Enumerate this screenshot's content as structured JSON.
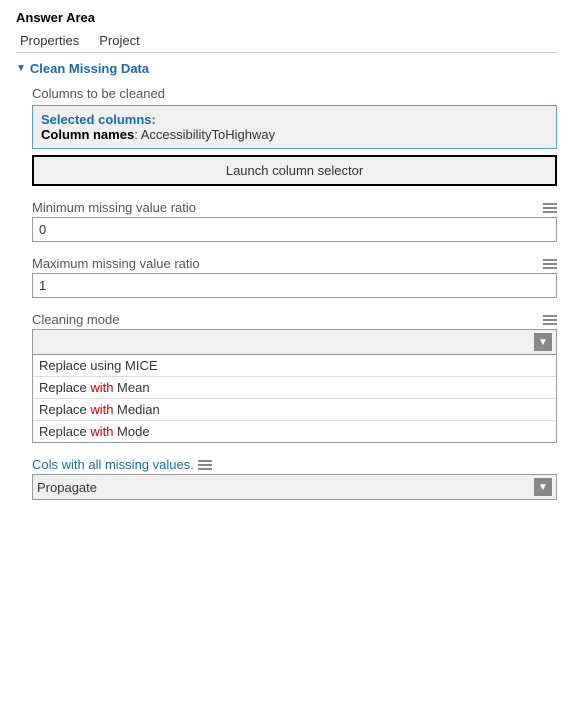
{
  "answerArea": {
    "title": "Answer Area"
  },
  "tabs": [
    {
      "label": "Properties"
    },
    {
      "label": "Project"
    }
  ],
  "section": {
    "title": "Clean Missing Data"
  },
  "columnsField": {
    "label": "Columns to be cleaned",
    "selectedTitle": "Selected columns:",
    "columnNamesLabel": "Column names",
    "columnNamesValue": "AccessibilityToHighway",
    "launchButton": "Launch column selector"
  },
  "minMissingField": {
    "label": "Minimum missing value ratio",
    "value": "0"
  },
  "maxMissingField": {
    "label": "Maximum missing value ratio",
    "value": "1"
  },
  "cleaningModeField": {
    "label": "Cleaning mode",
    "selectedValue": "",
    "options": [
      {
        "text": "Replace using MICE",
        "highlightWord": ""
      },
      {
        "text": "Replace ",
        "highlight": "with",
        "rest": " Mean"
      },
      {
        "text": "Replace ",
        "highlight": "with",
        "rest": " Median"
      },
      {
        "text": "Replace ",
        "highlight": "with",
        "rest": " Mode"
      }
    ]
  },
  "colsMissingField": {
    "label": "Cols with all missing values.",
    "selectedValue": "Propagate"
  },
  "icons": {
    "arrow": "▼",
    "sectionArrow": "▼",
    "hamburger": "≡"
  }
}
